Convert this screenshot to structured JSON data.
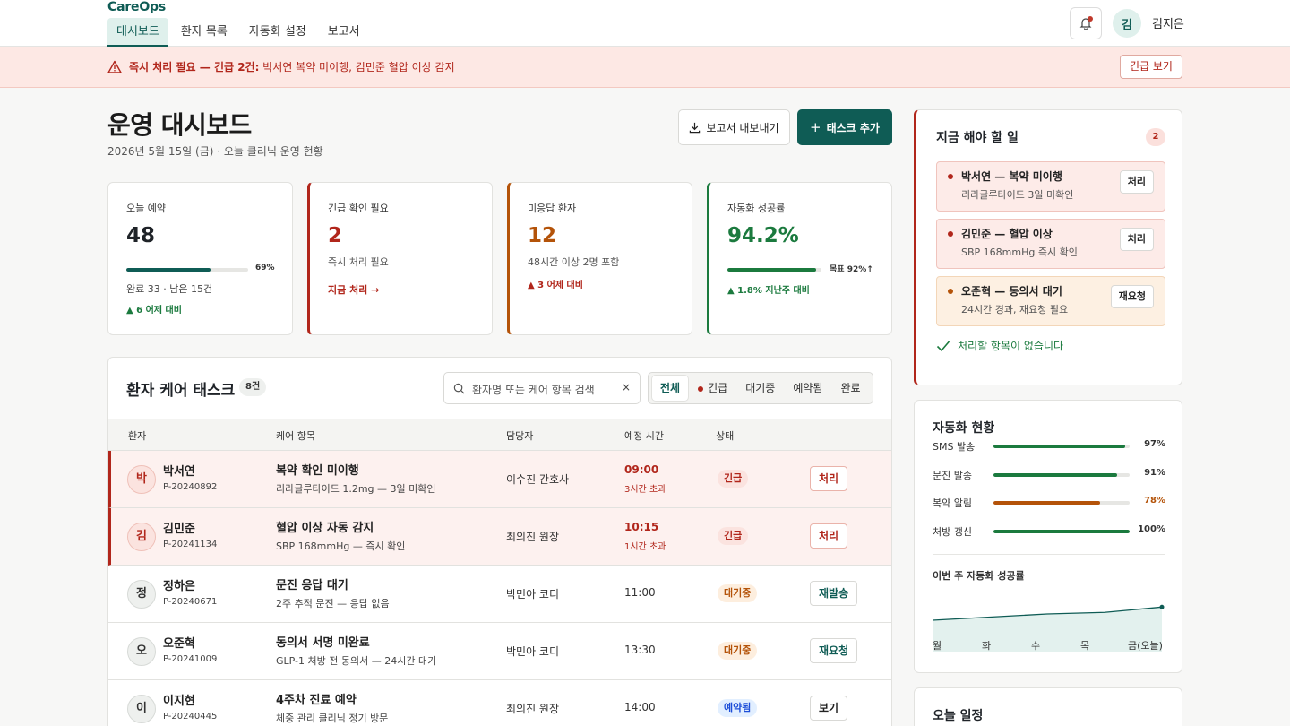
{
  "app": {
    "logo": "CareOps"
  },
  "nav": {
    "items": [
      "대시보드",
      "환자 목록",
      "자동화 설정",
      "보고서"
    ],
    "active": 0
  },
  "user": {
    "avatar": "김",
    "name": "김지은"
  },
  "alert": {
    "strong": "즉시 처리 필요 — 긴급 2건:",
    "text": " 박서연 복약 미이행, 김민준 혈압 이상 감지",
    "button": "긴급 보기"
  },
  "page": {
    "title": "운영 대시보드",
    "subtitle": "2026년 5월 15일 (금) · 오늘 클리닉 운영 현황",
    "export_label": "보고서 내보내기",
    "add_label": "태스크 추가"
  },
  "kpis": {
    "today": {
      "label": "오늘 예약",
      "value": "48",
      "progress": 69,
      "progress_label": "69%",
      "sub": "완료 33 · 남은 15건",
      "delta": "▲ 6 어제 대비"
    },
    "urgent": {
      "label": "긴급 확인 필요",
      "value": "2",
      "sub": "즉시 처리 필요",
      "link": "지금 처리 →"
    },
    "unanswered": {
      "label": "미응답 환자",
      "value": "12",
      "sub": "48시간 이상 2명 포함",
      "delta": "▲ 3 어제 대비"
    },
    "automation": {
      "label": "자동화 성공률",
      "value": "94.2%",
      "progress": 94.2,
      "target_label": "목표 92%↑",
      "delta": "▲ 1.8% 지난주 대비"
    }
  },
  "tasks": {
    "title": "환자 케어 태스크",
    "count": "8건",
    "search_placeholder": "환자명 또는 케어 항목 검색",
    "clear": "×",
    "filters": [
      "전체",
      "긴급",
      "대기중",
      "예약됨",
      "완료"
    ],
    "headers": [
      "환자",
      "케어 항목",
      "담당자",
      "예정 시간",
      "상태"
    ],
    "rows": [
      {
        "avatar": "박",
        "name": "박서연",
        "id": "P-20240892",
        "care": "복약 확인 미이행",
        "detail": "리라글루타이드 1.2mg — 3일 미확인",
        "assignee": "이수진 간호사",
        "time": "09:00",
        "late": "3시간 초과",
        "status": "긴급",
        "action": "처리"
      },
      {
        "avatar": "김",
        "name": "김민준",
        "id": "P-20241134",
        "care": "혈압 이상 자동 감지",
        "detail": "SBP 168mmHg — 즉시 확인",
        "assignee": "최의진 원장",
        "time": "10:15",
        "late": "1시간 초과",
        "status": "긴급",
        "action": "처리"
      },
      {
        "avatar": "정",
        "name": "정하은",
        "id": "P-20240671",
        "care": "문진 응답 대기",
        "detail": "2주 추적 문진 — 응답 없음",
        "assignee": "박민아 코디",
        "time": "11:00",
        "late": "",
        "status": "대기중",
        "action": "재발송"
      },
      {
        "avatar": "오",
        "name": "오준혁",
        "id": "P-20241009",
        "care": "동의서 서명 미완료",
        "detail": "GLP-1 처방 전 동의서 — 24시간 대기",
        "assignee": "박민아 코디",
        "time": "13:30",
        "late": "",
        "status": "대기중",
        "action": "재요청"
      },
      {
        "avatar": "이",
        "name": "이지현",
        "id": "P-20240445",
        "care": "4주차 진료 예약",
        "detail": "체중 관리 클리닉 정기 방문",
        "assignee": "최의진 원장",
        "time": "14:00",
        "late": "",
        "status": "예약됨",
        "action": "보기"
      }
    ]
  },
  "todo": {
    "title": "지금 해야 할 일",
    "count": "2",
    "items": [
      {
        "title": "박서연 — 복약 미이행",
        "sub": "리라글루타이드 3일 미확인",
        "button": "처리"
      },
      {
        "title": "김민준 — 혈압 이상",
        "sub": "SBP 168mmHg 즉시 확인",
        "button": "처리"
      },
      {
        "title": "오준혁 — 동의서 대기",
        "sub": "24시간 경과, 재요청 필요",
        "button": "재요청"
      }
    ],
    "done": "처리할 항목이 없습니다"
  },
  "automation": {
    "title": "자동화 현황",
    "rows": [
      {
        "label": "SMS 발송",
        "value": 97,
        "pct": "97%",
        "color": "#1b7a3e"
      },
      {
        "label": "문진 발송",
        "value": 91,
        "pct": "91%",
        "color": "#1b7a3e"
      },
      {
        "label": "복약 알림",
        "value": 78,
        "pct": "78%",
        "color": "#b45309"
      },
      {
        "label": "처방 갱신",
        "value": 100,
        "pct": "100%",
        "color": "#1b7a3e"
      }
    ],
    "chart_title": "이번 주 자동화 성공률",
    "chart_data": {
      "type": "area",
      "categories": [
        "월",
        "화",
        "수",
        "목",
        "금(오늘)"
      ],
      "values": [
        90.0,
        91.0,
        92.0,
        92.5,
        94.2
      ]
    }
  },
  "schedule": {
    "title": "오늘 일정"
  },
  "colors": {
    "brand": "#0f5c55",
    "urgent": "#b1261b",
    "warning": "#b45309",
    "success": "#1b7a3e"
  }
}
